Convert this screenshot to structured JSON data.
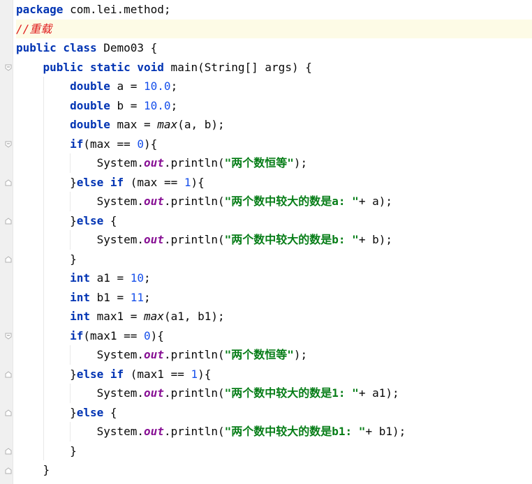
{
  "editor": {
    "language": "java",
    "lines": [
      [
        {
          "t": "kw",
          "v": "package"
        },
        {
          "t": "plain",
          "v": " com.lei.method;"
        }
      ],
      [
        {
          "t": "cmt-red",
          "v": "//重载"
        }
      ],
      [
        {
          "t": "kw",
          "v": "public class"
        },
        {
          "t": "plain",
          "v": " Demo03 {"
        }
      ],
      [
        {
          "t": "plain",
          "v": "    "
        },
        {
          "t": "kw",
          "v": "public static void"
        },
        {
          "t": "plain",
          "v": " main(String[] args) {"
        }
      ],
      [
        {
          "t": "plain",
          "v": "        "
        },
        {
          "t": "kw",
          "v": "double"
        },
        {
          "t": "plain",
          "v": " a = "
        },
        {
          "t": "num",
          "v": "10.0"
        },
        {
          "t": "plain",
          "v": ";"
        }
      ],
      [
        {
          "t": "plain",
          "v": "        "
        },
        {
          "t": "kw",
          "v": "double"
        },
        {
          "t": "plain",
          "v": " b = "
        },
        {
          "t": "num",
          "v": "10.0"
        },
        {
          "t": "plain",
          "v": ";"
        }
      ],
      [
        {
          "t": "plain",
          "v": "        "
        },
        {
          "t": "kw",
          "v": "double"
        },
        {
          "t": "plain",
          "v": " max = "
        },
        {
          "t": "static-call",
          "v": "max"
        },
        {
          "t": "plain",
          "v": "(a, b);"
        }
      ],
      [
        {
          "t": "plain",
          "v": "        "
        },
        {
          "t": "kw",
          "v": "if"
        },
        {
          "t": "plain",
          "v": "(max == "
        },
        {
          "t": "num",
          "v": "0"
        },
        {
          "t": "plain",
          "v": "){"
        }
      ],
      [
        {
          "t": "plain",
          "v": "            System."
        },
        {
          "t": "field",
          "v": "out"
        },
        {
          "t": "plain",
          "v": ".println("
        },
        {
          "t": "str",
          "v": "\"两个数恒等\""
        },
        {
          "t": "plain",
          "v": ");"
        }
      ],
      [
        {
          "t": "plain",
          "v": "        }"
        },
        {
          "t": "kw",
          "v": "else if"
        },
        {
          "t": "plain",
          "v": " (max == "
        },
        {
          "t": "num",
          "v": "1"
        },
        {
          "t": "plain",
          "v": "){"
        }
      ],
      [
        {
          "t": "plain",
          "v": "            System."
        },
        {
          "t": "field",
          "v": "out"
        },
        {
          "t": "plain",
          "v": ".println("
        },
        {
          "t": "str",
          "v": "\"两个数中较大的数是a: \""
        },
        {
          "t": "plain",
          "v": "+ a);"
        }
      ],
      [
        {
          "t": "plain",
          "v": "        }"
        },
        {
          "t": "kw",
          "v": "else"
        },
        {
          "t": "plain",
          "v": " {"
        }
      ],
      [
        {
          "t": "plain",
          "v": "            System."
        },
        {
          "t": "field",
          "v": "out"
        },
        {
          "t": "plain",
          "v": ".println("
        },
        {
          "t": "str",
          "v": "\"两个数中较大的数是b: \""
        },
        {
          "t": "plain",
          "v": "+ b);"
        }
      ],
      [
        {
          "t": "plain",
          "v": "        }"
        }
      ],
      [
        {
          "t": "plain",
          "v": "        "
        },
        {
          "t": "kw",
          "v": "int"
        },
        {
          "t": "plain",
          "v": " a1 = "
        },
        {
          "t": "num",
          "v": "10"
        },
        {
          "t": "plain",
          "v": ";"
        }
      ],
      [
        {
          "t": "plain",
          "v": "        "
        },
        {
          "t": "kw",
          "v": "int"
        },
        {
          "t": "plain",
          "v": " b1 = "
        },
        {
          "t": "num",
          "v": "11"
        },
        {
          "t": "plain",
          "v": ";"
        }
      ],
      [
        {
          "t": "plain",
          "v": "        "
        },
        {
          "t": "kw",
          "v": "int"
        },
        {
          "t": "plain",
          "v": " max1 = "
        },
        {
          "t": "static-call",
          "v": "max"
        },
        {
          "t": "plain",
          "v": "(a1, b1);"
        }
      ],
      [
        {
          "t": "plain",
          "v": "        "
        },
        {
          "t": "kw",
          "v": "if"
        },
        {
          "t": "plain",
          "v": "(max1 == "
        },
        {
          "t": "num",
          "v": "0"
        },
        {
          "t": "plain",
          "v": "){"
        }
      ],
      [
        {
          "t": "plain",
          "v": "            System."
        },
        {
          "t": "field",
          "v": "out"
        },
        {
          "t": "plain",
          "v": ".println("
        },
        {
          "t": "str",
          "v": "\"两个数恒等\""
        },
        {
          "t": "plain",
          "v": ");"
        }
      ],
      [
        {
          "t": "plain",
          "v": "        }"
        },
        {
          "t": "kw",
          "v": "else if"
        },
        {
          "t": "plain",
          "v": " (max1 == "
        },
        {
          "t": "num",
          "v": "1"
        },
        {
          "t": "plain",
          "v": "){"
        }
      ],
      [
        {
          "t": "plain",
          "v": "            System."
        },
        {
          "t": "field",
          "v": "out"
        },
        {
          "t": "plain",
          "v": ".println("
        },
        {
          "t": "str",
          "v": "\"两个数中较大的数是1: \""
        },
        {
          "t": "plain",
          "v": "+ a1);"
        }
      ],
      [
        {
          "t": "plain",
          "v": "        }"
        },
        {
          "t": "kw",
          "v": "else"
        },
        {
          "t": "plain",
          "v": " {"
        }
      ],
      [
        {
          "t": "plain",
          "v": "            System."
        },
        {
          "t": "field",
          "v": "out"
        },
        {
          "t": "plain",
          "v": ".println("
        },
        {
          "t": "str",
          "v": "\"两个数中较大的数是b1: \""
        },
        {
          "t": "plain",
          "v": "+ b1);"
        }
      ],
      [
        {
          "t": "plain",
          "v": "        }"
        }
      ],
      [
        {
          "t": "plain",
          "v": "    }"
        }
      ]
    ],
    "highlighted_line": 2,
    "fold_markers": [
      {
        "line": 4,
        "icon": "fold-open-icon"
      },
      {
        "line": 8,
        "icon": "fold-open-icon"
      },
      {
        "line": 10,
        "icon": "fold-close-icon"
      },
      {
        "line": 12,
        "icon": "fold-close-icon"
      },
      {
        "line": 14,
        "icon": "fold-close-icon"
      },
      {
        "line": 18,
        "icon": "fold-open-icon"
      },
      {
        "line": 20,
        "icon": "fold-close-icon"
      },
      {
        "line": 22,
        "icon": "fold-close-icon"
      },
      {
        "line": 24,
        "icon": "fold-close-icon"
      },
      {
        "line": 25,
        "icon": "fold-close-icon"
      }
    ],
    "colors": {
      "keyword": "#0033b3",
      "number": "#1750eb",
      "string": "#067d17",
      "field": "#871094",
      "comment": "#e01e1e",
      "highlight": "#fdfbe6",
      "gutter": "#f0f0f0"
    }
  }
}
